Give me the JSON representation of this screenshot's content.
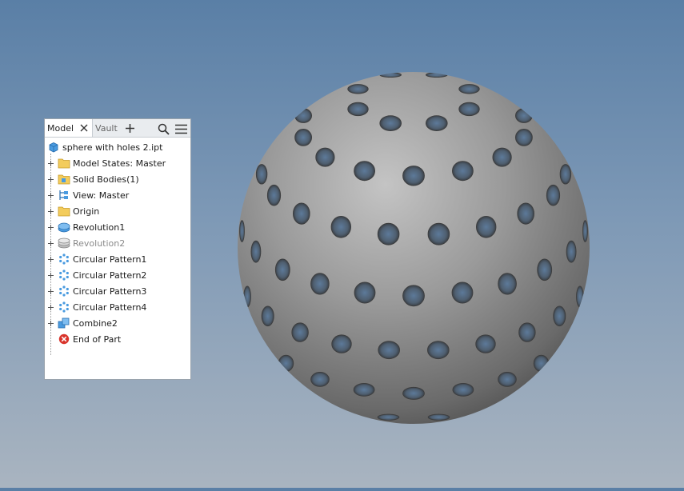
{
  "browser": {
    "tabs": [
      {
        "label": "Model",
        "active": true
      },
      {
        "label": "Vault",
        "active": false
      }
    ],
    "root": {
      "label": "sphere with holes 2.ipt",
      "icon": "part-cube-icon"
    },
    "items": [
      {
        "label": "Model States: Master",
        "icon": "folder-icon",
        "expandable": true,
        "suppressed": false
      },
      {
        "label": "Solid Bodies(1)",
        "icon": "solid-bodies-folder-icon",
        "expandable": true,
        "suppressed": false
      },
      {
        "label": "View: Master",
        "icon": "view-icon",
        "expandable": true,
        "suppressed": false
      },
      {
        "label": "Origin",
        "icon": "folder-icon",
        "expandable": true,
        "suppressed": false
      },
      {
        "label": "Revolution1",
        "icon": "revolve-icon",
        "expandable": true,
        "suppressed": false
      },
      {
        "label": "Revolution2",
        "icon": "revolve-icon",
        "expandable": true,
        "suppressed": true
      },
      {
        "label": "Circular Pattern1",
        "icon": "circular-pattern-icon",
        "expandable": true,
        "suppressed": false
      },
      {
        "label": "Circular Pattern2",
        "icon": "circular-pattern-icon",
        "expandable": true,
        "suppressed": false
      },
      {
        "label": "Circular Pattern3",
        "icon": "circular-pattern-icon",
        "expandable": true,
        "suppressed": false
      },
      {
        "label": "Circular Pattern4",
        "icon": "circular-pattern-icon",
        "expandable": true,
        "suppressed": false
      },
      {
        "label": "Combine2",
        "icon": "combine-icon",
        "expandable": true,
        "suppressed": false
      },
      {
        "label": "End of Part",
        "icon": "end-of-part-icon",
        "expandable": false,
        "suppressed": false
      }
    ]
  },
  "colors": {
    "background_top": "#5a7fa6",
    "background_bottom": "#a9b4c0",
    "sphere": "#8d8d8d",
    "end_of_part": "#d9342b"
  }
}
